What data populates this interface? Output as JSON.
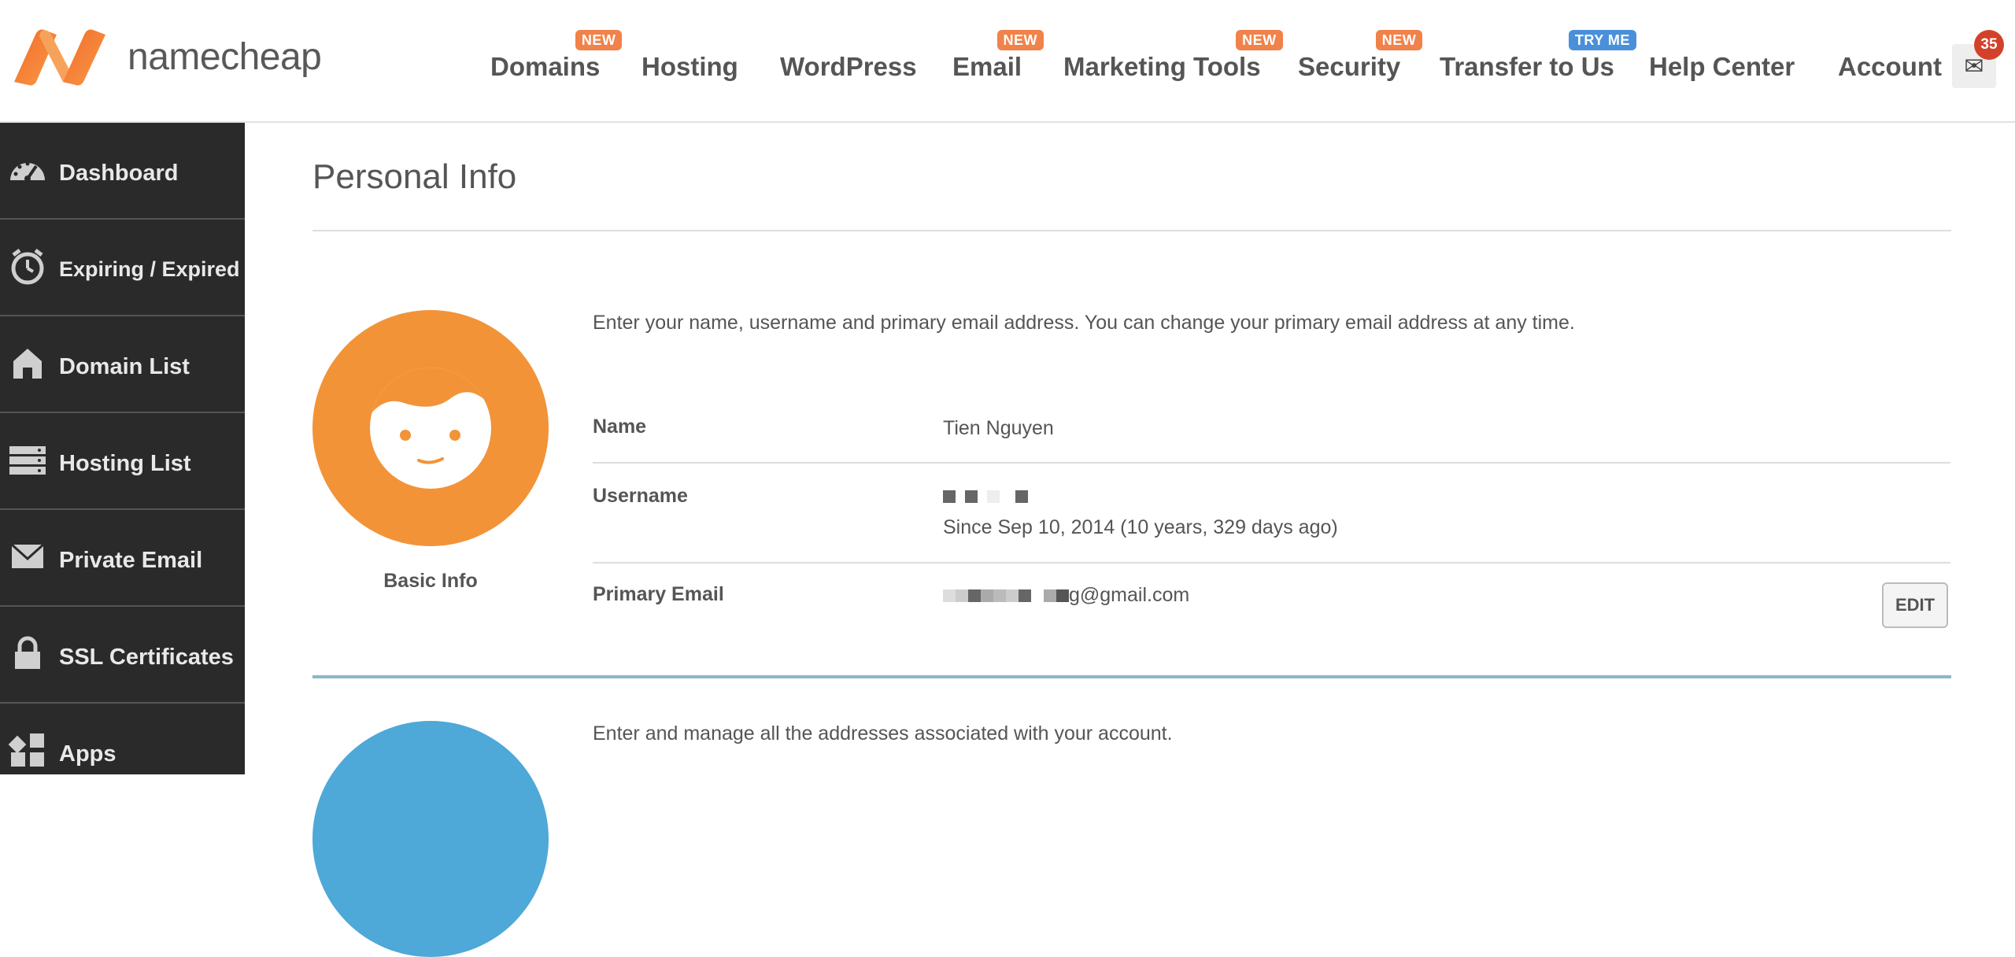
{
  "header": {
    "brand": "namecheap",
    "nav": [
      {
        "label": "Domains",
        "badge": "NEW",
        "badge_color": "#f0824a"
      },
      {
        "label": "Hosting"
      },
      {
        "label": "WordPress"
      },
      {
        "label": "Email",
        "badge": "NEW",
        "badge_color": "#f0824a"
      },
      {
        "label": "Marketing Tools",
        "badge": "NEW",
        "badge_color": "#f0824a"
      },
      {
        "label": "Security",
        "badge": "NEW",
        "badge_color": "#f0824a"
      },
      {
        "label": "Transfer to Us",
        "badge": "TRY ME",
        "badge_color": "#4a90d9"
      },
      {
        "label": "Help Center"
      },
      {
        "label": "Account"
      }
    ],
    "mail_count": "35"
  },
  "sidebar": {
    "items": [
      {
        "label": "Dashboard",
        "icon": "speedometer-icon"
      },
      {
        "label": "Expiring / Expired",
        "icon": "timer-icon"
      },
      {
        "label": "Domain List",
        "icon": "home-icon"
      },
      {
        "label": "Hosting List",
        "icon": "server-icon"
      },
      {
        "label": "Private Email",
        "icon": "envelope-icon"
      },
      {
        "label": "SSL Certificates",
        "icon": "lock-icon"
      },
      {
        "label": "Apps",
        "icon": "apps-icon"
      }
    ]
  },
  "main": {
    "title": "Personal Info",
    "basic_info": {
      "caption": "Basic Info",
      "intro": "Enter your name, username and primary email address. You can change your primary email address at any time.",
      "name_label": "Name",
      "name_value": "Tien Nguyen",
      "username_label": "Username",
      "username_since": "Since Sep 10, 2014 (10 years, 329 days ago)",
      "email_label": "Primary Email",
      "email_suffix": "g@gmail.com",
      "edit_label": "EDIT"
    },
    "addresses": {
      "intro": "Enter and manage all the addresses associated with your account."
    }
  },
  "colors": {
    "brand_orange": "#f29338",
    "sidebar_bg": "#2a2a2a",
    "accent_blue": "#4ea8d8"
  }
}
